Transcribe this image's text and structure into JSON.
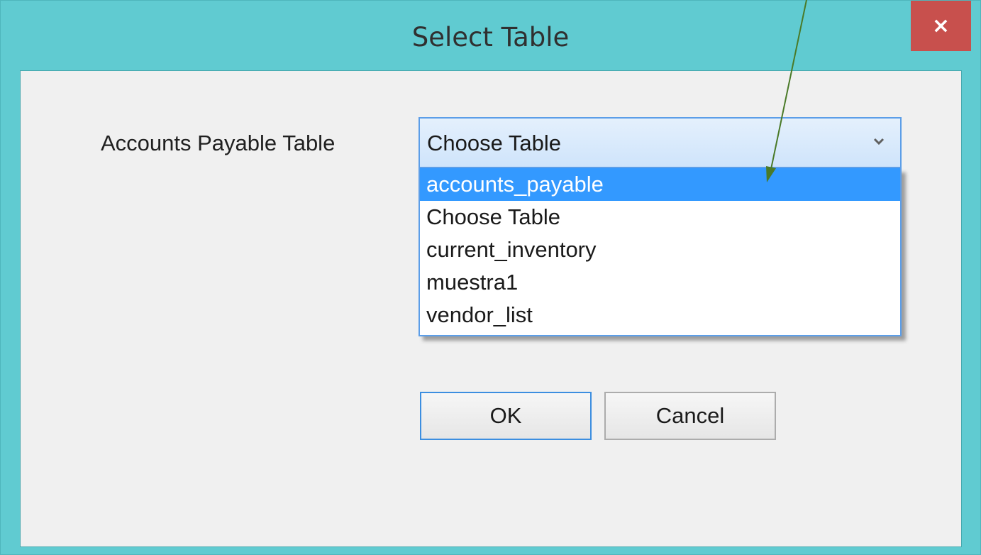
{
  "window": {
    "title": "Select Table",
    "close_glyph": "×"
  },
  "form": {
    "label": "Accounts Payable Table",
    "combo_value": "Choose Table",
    "options": [
      {
        "label": "accounts_payable",
        "selected": true
      },
      {
        "label": "Choose Table",
        "selected": false
      },
      {
        "label": "current_inventory",
        "selected": false
      },
      {
        "label": "muestra1",
        "selected": false
      },
      {
        "label": "vendor_list",
        "selected": false
      }
    ]
  },
  "buttons": {
    "ok": "OK",
    "cancel": "Cancel"
  },
  "colors": {
    "title_bar": "#60cbd1",
    "close_button": "#c8504d",
    "selection": "#3399ff",
    "annotation_arrow": "#4a7a28"
  },
  "icons": {
    "combo_arrow": "chevron-down-icon",
    "close": "close-icon",
    "annotation": "annotation-arrow"
  }
}
